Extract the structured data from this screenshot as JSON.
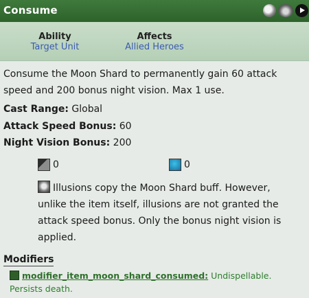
{
  "title": "Consume",
  "header": {
    "ability_label": "Ability",
    "ability_value": "Target Unit",
    "affects_label": "Affects",
    "affects_value": "Allied Heroes"
  },
  "description": "Consume the Moon Shard to permanently gain 60 attack speed and 200 bonus night vision. Max 1 use.",
  "stats": [
    {
      "label": "Cast Range:",
      "value": "Global"
    },
    {
      "label": "Attack Speed Bonus:",
      "value": "60"
    },
    {
      "label": "Night Vision Bonus:",
      "value": "200"
    }
  ],
  "cooldown": "0",
  "mana_cost": "0",
  "note": "Illusions copy the Moon Shard buff. However, unlike the item itself, illusions are not granted the attack speed bonus. Only the bonus night vision is applied.",
  "modifiers_heading": "Modifiers",
  "modifier": {
    "name": "modifier_item_moon_shard_consumed:",
    "description": "Undispellable. Persists death."
  },
  "colors": {
    "titlebar": "#2d622b",
    "header_band": "#c1d8c2",
    "link_blue": "#3a5bb0",
    "modifier_green": "#2e7d2e"
  },
  "icons": [
    "moon-shard-icon",
    "beast-icon",
    "play-icon",
    "cooldown-icon",
    "mana-icon",
    "illusion-note-icon",
    "modifier-icon"
  ]
}
